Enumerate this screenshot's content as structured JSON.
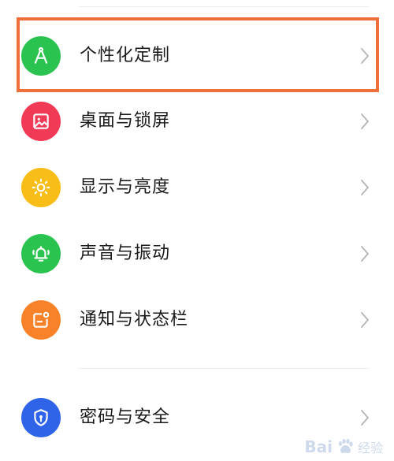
{
  "settings": {
    "items": [
      {
        "label": "个性化定制",
        "icon": "compass-icon",
        "color": "#2bc34f"
      },
      {
        "label": "桌面与锁屏",
        "icon": "image-icon",
        "color": "#f03a56"
      },
      {
        "label": "显示与亮度",
        "icon": "sun-icon",
        "color": "#f8bd16"
      },
      {
        "label": "声音与振动",
        "icon": "bell-icon",
        "color": "#2bc34f"
      },
      {
        "label": "通知与状态栏",
        "icon": "notification-icon",
        "color": "#f7822a"
      },
      {
        "label": "密码与安全",
        "icon": "shield-lock-icon",
        "color": "#2f63e8"
      }
    ]
  },
  "highlight": {
    "color": "#f0703c"
  },
  "watermark": {
    "brand": "Bai",
    "suffix": "经验"
  }
}
